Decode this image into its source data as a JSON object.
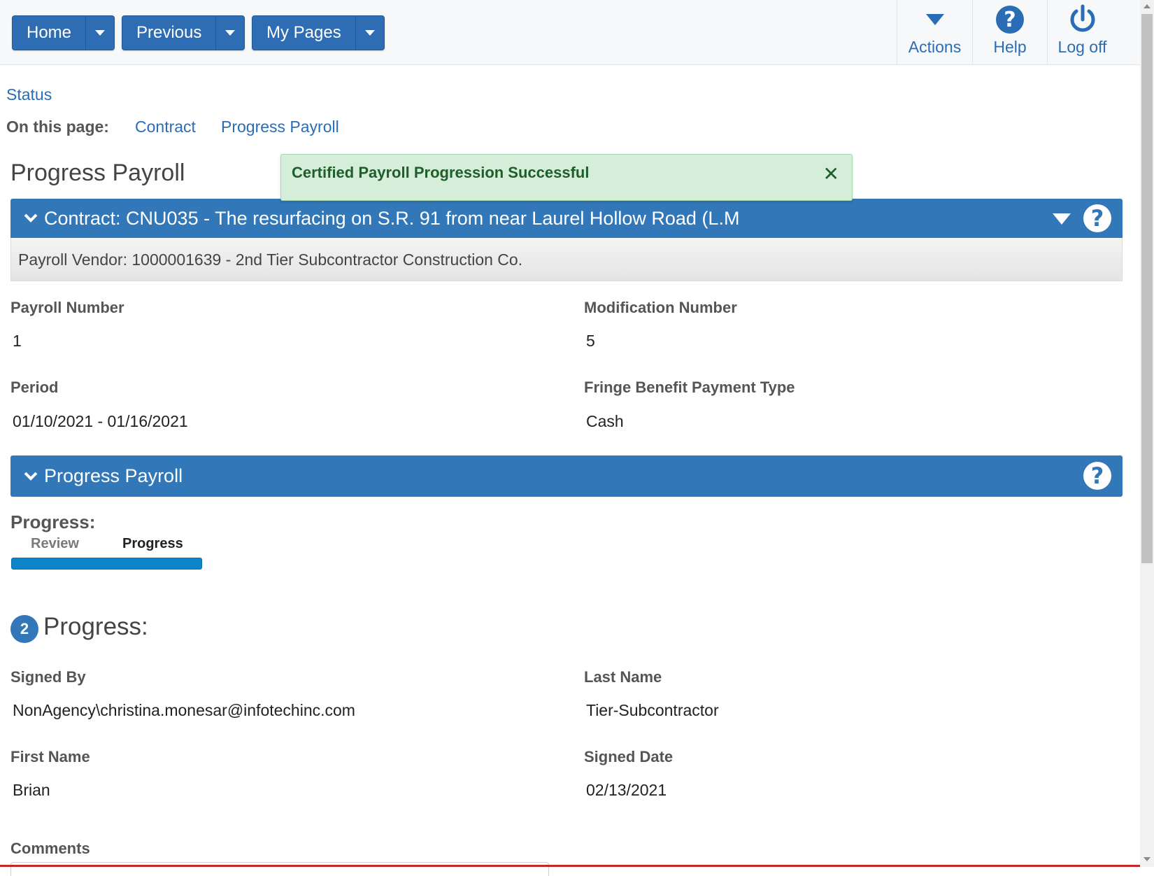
{
  "nav": {
    "buttons": [
      {
        "label": "Home"
      },
      {
        "label": "Previous"
      },
      {
        "label": "My Pages"
      }
    ],
    "tools": [
      {
        "label": "Actions",
        "icon": "actions-caret-icon"
      },
      {
        "label": "Help",
        "icon": "help-icon"
      },
      {
        "label": "Log off",
        "icon": "power-icon"
      }
    ]
  },
  "breadcrumb": {
    "status_link": "Status"
  },
  "on_this_page": {
    "label": "On this page:",
    "links": [
      "Contract",
      "Progress Payroll"
    ]
  },
  "page_title": "Progress Payroll",
  "toast": {
    "message": "Certified Payroll Progression Successful",
    "close": "✕"
  },
  "contract_panel": {
    "title": "Contract: CNU035 - The resurfacing on S.R. 91 from near Laurel Hollow Road (L.M",
    "vendor": "Payroll Vendor: 1000001639 - 2nd Tier Subcontractor Construction Co."
  },
  "contract_fields": {
    "payroll_number_label": "Payroll Number",
    "payroll_number": "1",
    "modification_number_label": "Modification Number",
    "modification_number": "5",
    "period_label": "Period",
    "period": "01/10/2021 - 01/16/2021",
    "fringe_label": "Fringe Benefit Payment Type",
    "fringe": "Cash"
  },
  "progress_panel": {
    "title": "Progress Payroll",
    "progress_label": "Progress:",
    "steps": [
      "Review",
      "Progress"
    ],
    "progress_fraction": 1.0
  },
  "section": {
    "number": "2",
    "title": "Progress:",
    "signed_by_label": "Signed By",
    "signed_by": "NonAgency\\christina.monesar@infotechinc.com",
    "last_name_label": "Last Name",
    "last_name": "Tier-Subcontractor",
    "first_name_label": "First Name",
    "first_name": "Brian",
    "signed_date_label": "Signed Date",
    "signed_date": "02/13/2021",
    "comments_label": "Comments"
  },
  "colors": {
    "primary": "#3277b7",
    "link": "#2a6db5",
    "toast_bg": "#d5eed9",
    "toast_text": "#1f5e2b",
    "progress_bar": "#0d86c9"
  }
}
